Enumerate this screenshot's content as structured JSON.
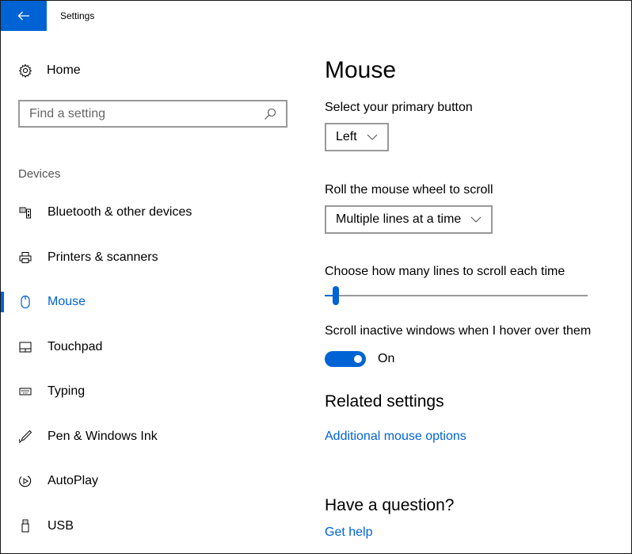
{
  "window": {
    "title": "Settings"
  },
  "sidebar": {
    "home_label": "Home",
    "search_placeholder": "Find a setting",
    "section_label": "Devices",
    "items": [
      {
        "label": "Bluetooth & other devices",
        "icon": "bluetooth-devices-icon",
        "active": false
      },
      {
        "label": "Printers & scanners",
        "icon": "printer-icon",
        "active": false
      },
      {
        "label": "Mouse",
        "icon": "mouse-icon",
        "active": true
      },
      {
        "label": "Touchpad",
        "icon": "touchpad-icon",
        "active": false
      },
      {
        "label": "Typing",
        "icon": "keyboard-icon",
        "active": false
      },
      {
        "label": "Pen & Windows Ink",
        "icon": "pen-icon",
        "active": false
      },
      {
        "label": "AutoPlay",
        "icon": "autoplay-icon",
        "active": false
      },
      {
        "label": "USB",
        "icon": "usb-icon",
        "active": false
      }
    ]
  },
  "main": {
    "title": "Mouse",
    "primary_button": {
      "label": "Select your primary button",
      "value": "Left"
    },
    "wheel_scroll": {
      "label": "Roll the mouse wheel to scroll",
      "value": "Multiple lines at a time"
    },
    "lines_scroll": {
      "label": "Choose how many lines to scroll each time",
      "value_fraction": 0.03
    },
    "inactive_scroll": {
      "label": "Scroll inactive windows when I hover over them",
      "state": "On"
    },
    "related": {
      "title": "Related settings",
      "link": "Additional mouse options"
    },
    "question": {
      "title": "Have a question?",
      "link": "Get help"
    }
  },
  "colors": {
    "accent": "#0063d4",
    "border": "#999999",
    "text": "#000000"
  }
}
